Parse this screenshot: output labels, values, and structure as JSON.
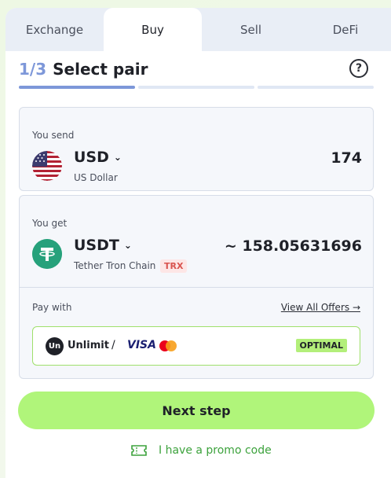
{
  "tabs": [
    {
      "label": "Exchange",
      "active": false
    },
    {
      "label": "Buy",
      "active": true
    },
    {
      "label": "Sell",
      "active": false
    },
    {
      "label": "DeFi",
      "active": false
    }
  ],
  "step": {
    "number": "1/3",
    "title": "Select pair",
    "progress_segments": 3,
    "completed_segments": 1
  },
  "help_icon": "question-circle-icon",
  "send": {
    "label": "You send",
    "currency_code": "USD",
    "currency_name": "US Dollar",
    "amount": "174",
    "flag_icon": "us-flag-icon"
  },
  "get": {
    "label": "You get",
    "currency_code": "USDT",
    "currency_name": "Tether Tron Chain",
    "chain_badge": "TRX",
    "amount": "~ 158.05631696",
    "token_icon": "tether-icon"
  },
  "pay_with": {
    "label": "Pay with",
    "view_all_label": "View All Offers →",
    "provider_name": "Unlimit",
    "provider_logo_text": "Un",
    "separator": "/",
    "card_brand": "VISA",
    "badge": "OPTIMAL"
  },
  "next_button": {
    "label": "Next step"
  },
  "promo": {
    "label": "I have a promo code",
    "icon": "ticket-icon"
  },
  "colors": {
    "accent_green": "#b0f57a",
    "step_blue": "#7d97d9",
    "promo_green": "#3ca23c",
    "badge_red": "#d9534f"
  }
}
